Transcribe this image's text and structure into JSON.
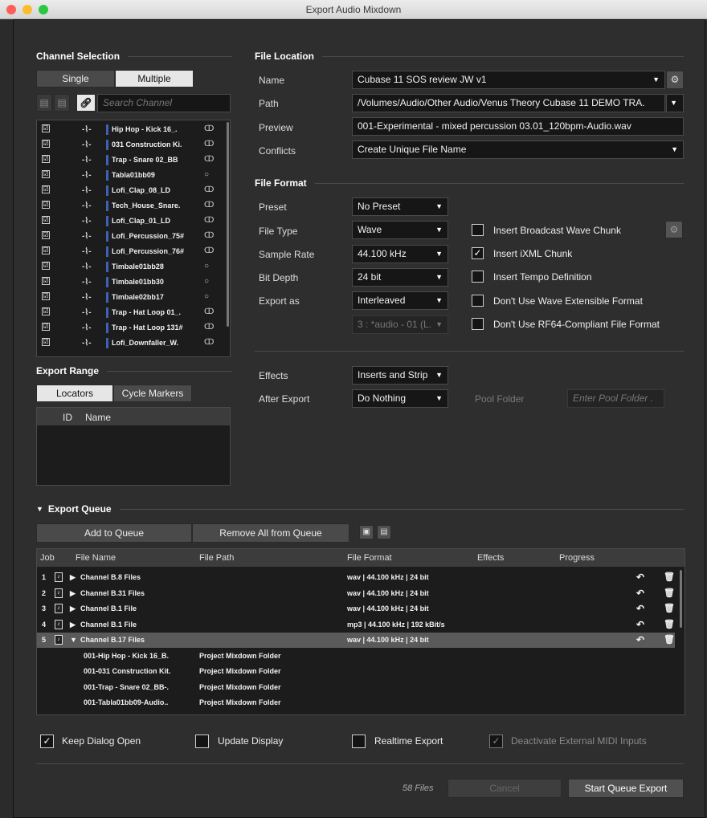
{
  "window": {
    "title": "Export Audio Mixdown"
  },
  "channel_selection": {
    "heading": "Channel Selection",
    "tabs": [
      "Single",
      "Multiple"
    ],
    "search_placeholder": "Search Channel",
    "channels": [
      {
        "name": "Hip Hop - Kick 16_.",
        "checked": true,
        "stereo": true
      },
      {
        "name": "031 Construction Ki.",
        "checked": true,
        "stereo": true
      },
      {
        "name": "Trap - Snare 02_BB",
        "checked": true,
        "stereo": true
      },
      {
        "name": "Tabla01bb09",
        "checked": true,
        "stereo": false
      },
      {
        "name": "Lofi_Clap_08_LD",
        "checked": true,
        "stereo": true
      },
      {
        "name": "Tech_House_Snare.",
        "checked": true,
        "stereo": true
      },
      {
        "name": "Lofi_Clap_01_LD",
        "checked": true,
        "stereo": true
      },
      {
        "name": "Lofi_Percussion_75#",
        "checked": true,
        "stereo": true
      },
      {
        "name": "Lofi_Percussion_76#",
        "checked": true,
        "stereo": true
      },
      {
        "name": "Timbale01bb28",
        "checked": true,
        "stereo": false
      },
      {
        "name": "Timbale01bb30",
        "checked": true,
        "stereo": false
      },
      {
        "name": "Timbale02bb17",
        "checked": true,
        "stereo": false
      },
      {
        "name": "Trap - Hat Loop 01_.",
        "checked": true,
        "stereo": true
      },
      {
        "name": "Trap - Hat Loop 131#",
        "checked": true,
        "stereo": true
      },
      {
        "name": "Lofi_Downfaller_W.",
        "checked": true,
        "stereo": true
      }
    ],
    "check_glyph": "☑",
    "waveform_glyph": "-⌇-",
    "stereo_glyph": "ↀ",
    "mono_glyph": "○"
  },
  "export_range": {
    "heading": "Export Range",
    "tabs": [
      "Locators",
      "Cycle Markers"
    ],
    "columns": [
      "ID",
      "Name"
    ]
  },
  "file_location": {
    "heading": "File Location",
    "name_label": "Name",
    "name_value": "Cubase 11 SOS review JW v1",
    "path_label": "Path",
    "path_value": "/Volumes/Audio/Other Audio/Venus Theory Cubase 11 DEMO TRA.",
    "preview_label": "Preview",
    "preview_value": "001-Experimental - mixed percussion 03.01_120bpm-Audio.wav",
    "conflicts_label": "Conflicts",
    "conflicts_value": "Create Unique File Name"
  },
  "file_format": {
    "heading": "File Format",
    "preset_label": "Preset",
    "preset_value": "No Preset",
    "file_type_label": "File Type",
    "file_type_value": "Wave",
    "sample_rate_label": "Sample Rate",
    "sample_rate_value": "44.100 kHz",
    "bit_depth_label": "Bit Depth",
    "bit_depth_value": "24 bit",
    "export_as_label": "Export as",
    "export_as_value": "Interleaved",
    "channel_value": "3 : *audio - 01 (L.",
    "options": [
      {
        "label": "Insert Broadcast Wave Chunk",
        "checked": false
      },
      {
        "label": "Insert iXML Chunk",
        "checked": true
      },
      {
        "label": "Insert Tempo Definition",
        "checked": false
      },
      {
        "label": "Don't Use Wave Extensible Format",
        "checked": false
      },
      {
        "label": "Don't Use RF64-Compliant File Format",
        "checked": false
      }
    ]
  },
  "post": {
    "effects_label": "Effects",
    "effects_value": "Inserts and Strip",
    "after_export_label": "After Export",
    "after_export_value": "Do Nothing",
    "pool_folder_label": "Pool Folder",
    "pool_folder_placeholder": "Enter Pool Folder ."
  },
  "queue": {
    "heading": "Export Queue",
    "add_label": "Add to Queue",
    "remove_label": "Remove All from Queue",
    "columns": {
      "job": "Job",
      "file_name": "File Name",
      "file_path": "File Path",
      "file_format": "File Format",
      "effects": "Effects",
      "progress": "Progress"
    },
    "jobs": [
      {
        "num": "1",
        "name": "Channel B.8 Files",
        "format": "wav | 44.100 kHz | 24 bit",
        "expanded": false
      },
      {
        "num": "2",
        "name": "Channel B.31 Files",
        "format": "wav | 44.100 kHz | 24 bit",
        "expanded": false
      },
      {
        "num": "3",
        "name": "Channel B.1 File",
        "format": "wav | 44.100 kHz | 24 bit",
        "expanded": false
      },
      {
        "num": "4",
        "name": "Channel B.1 File",
        "format": "mp3 | 44.100 kHz | 192 kBit/s",
        "expanded": false
      },
      {
        "num": "5",
        "name": "Channel B.17 Files",
        "format": "wav | 44.100 kHz | 24 bit",
        "expanded": true
      }
    ],
    "sub_items": [
      {
        "name": "001-Hip Hop - Kick 16_B.",
        "path": "Project Mixdown Folder"
      },
      {
        "name": "001-031 Construction Kit.",
        "path": "Project Mixdown Folder"
      },
      {
        "name": "001-Trap - Snare 02_BB-.",
        "path": "Project Mixdown Folder"
      },
      {
        "name": "001-Tabla01bb09-Audio..",
        "path": "Project Mixdown Folder"
      }
    ]
  },
  "bottom": {
    "keep_dialog_open": {
      "label": "Keep Dialog Open",
      "checked": true
    },
    "update_display": {
      "label": "Update Display",
      "checked": false
    },
    "realtime_export": {
      "label": "Realtime Export",
      "checked": false
    },
    "deactivate_midi": {
      "label": "Deactivate External MIDI Inputs",
      "checked": true
    },
    "file_count": "58 Files",
    "cancel_label": "Cancel",
    "start_label": "Start Queue Export"
  }
}
